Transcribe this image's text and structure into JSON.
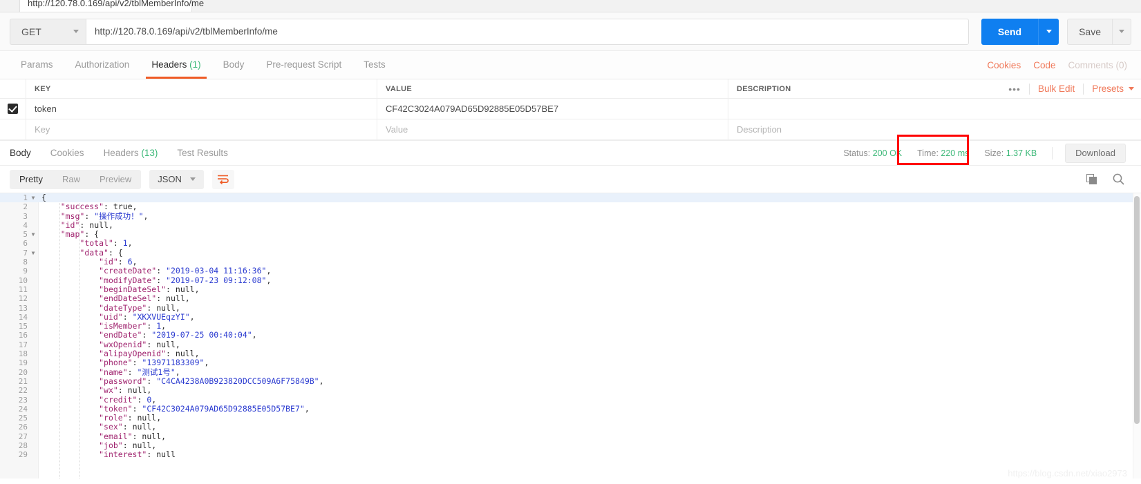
{
  "tabstrip": {
    "title": "http://120.78.0.169/api/v2/tblMemberInfo/me"
  },
  "request": {
    "method": "GET",
    "method_caret": "caret-down-icon",
    "url": "http://120.78.0.169/api/v2/tblMemberInfo/me",
    "send_label": "Send",
    "save_label": "Save",
    "send_color": "#0f7ff0"
  },
  "request_tabs": [
    {
      "label": "Params",
      "count": "",
      "active": false
    },
    {
      "label": "Authorization",
      "count": "",
      "active": false
    },
    {
      "label": "Headers",
      "count": "(1)",
      "active": true
    },
    {
      "label": "Body",
      "count": "",
      "active": false
    },
    {
      "label": "Pre-request Script",
      "count": "",
      "active": false
    },
    {
      "label": "Tests",
      "count": "",
      "active": false
    }
  ],
  "request_tabs_right": {
    "cookies": "Cookies",
    "code": "Code",
    "comments": "Comments (0)",
    "accent": "#ef5b25"
  },
  "headers_table": {
    "columns": {
      "key": "KEY",
      "value": "VALUE",
      "description": "DESCRIPTION"
    },
    "actions": {
      "dots": "•••",
      "bulk_edit": "Bulk Edit",
      "presets": "Presets"
    },
    "rows": [
      {
        "checked": true,
        "key": "token",
        "value": "CF42C3024A079AD65D92885E05D57BE7",
        "description": ""
      }
    ],
    "placeholders": {
      "key": "Key",
      "value": "Value",
      "description": "Description"
    }
  },
  "response_tabs": [
    {
      "label": "Body",
      "count": "",
      "active": true
    },
    {
      "label": "Cookies",
      "count": "",
      "active": false
    },
    {
      "label": "Headers",
      "count": "(13)",
      "active": false
    },
    {
      "label": "Test Results",
      "count": "",
      "active": false
    }
  ],
  "response_meta": {
    "status_label": "Status:",
    "status_value": "200 OK",
    "time_label": "Time:",
    "time_value": "220 ms",
    "size_label": "Size:",
    "size_value": "1.37 KB",
    "download_label": "Download",
    "ok_color": "#3cb878",
    "highlight_color": "#ff0000"
  },
  "body_toolbar": {
    "views": [
      {
        "label": "Pretty",
        "active": true
      },
      {
        "label": "Raw",
        "active": false
      },
      {
        "label": "Preview",
        "active": false
      }
    ],
    "format": "JSON",
    "wrap_icon": "word-wrap-icon",
    "copy_icon": "copy-icon",
    "search_icon": "search-icon"
  },
  "code_lines": [
    {
      "n": "1",
      "fold": true,
      "indent": 0,
      "tokens": [
        {
          "t": "p",
          "v": "{"
        }
      ]
    },
    {
      "n": "2",
      "fold": false,
      "indent": 1,
      "tokens": [
        {
          "t": "k",
          "v": "\"success\""
        },
        {
          "t": "p",
          "v": ": "
        },
        {
          "t": "b",
          "v": "true"
        },
        {
          "t": "p",
          "v": ","
        }
      ]
    },
    {
      "n": "3",
      "fold": false,
      "indent": 1,
      "tokens": [
        {
          "t": "k",
          "v": "\"msg\""
        },
        {
          "t": "p",
          "v": ": "
        },
        {
          "t": "s",
          "v": "\"操作成功！\""
        },
        {
          "t": "p",
          "v": ","
        }
      ]
    },
    {
      "n": "4",
      "fold": false,
      "indent": 1,
      "tokens": [
        {
          "t": "k",
          "v": "\"id\""
        },
        {
          "t": "p",
          "v": ": "
        },
        {
          "t": "b",
          "v": "null"
        },
        {
          "t": "p",
          "v": ","
        }
      ]
    },
    {
      "n": "5",
      "fold": true,
      "indent": 1,
      "tokens": [
        {
          "t": "k",
          "v": "\"map\""
        },
        {
          "t": "p",
          "v": ": {"
        }
      ]
    },
    {
      "n": "6",
      "fold": false,
      "indent": 2,
      "tokens": [
        {
          "t": "k",
          "v": "\"total\""
        },
        {
          "t": "p",
          "v": ": "
        },
        {
          "t": "n",
          "v": "1"
        },
        {
          "t": "p",
          "v": ","
        }
      ]
    },
    {
      "n": "7",
      "fold": true,
      "indent": 2,
      "tokens": [
        {
          "t": "k",
          "v": "\"data\""
        },
        {
          "t": "p",
          "v": ": {"
        }
      ]
    },
    {
      "n": "8",
      "fold": false,
      "indent": 3,
      "tokens": [
        {
          "t": "k",
          "v": "\"id\""
        },
        {
          "t": "p",
          "v": ": "
        },
        {
          "t": "n",
          "v": "6"
        },
        {
          "t": "p",
          "v": ","
        }
      ]
    },
    {
      "n": "9",
      "fold": false,
      "indent": 3,
      "tokens": [
        {
          "t": "k",
          "v": "\"createDate\""
        },
        {
          "t": "p",
          "v": ": "
        },
        {
          "t": "s",
          "v": "\"2019-03-04 11:16:36\""
        },
        {
          "t": "p",
          "v": ","
        }
      ]
    },
    {
      "n": "10",
      "fold": false,
      "indent": 3,
      "tokens": [
        {
          "t": "k",
          "v": "\"modifyDate\""
        },
        {
          "t": "p",
          "v": ": "
        },
        {
          "t": "s",
          "v": "\"2019-07-23 09:12:08\""
        },
        {
          "t": "p",
          "v": ","
        }
      ]
    },
    {
      "n": "11",
      "fold": false,
      "indent": 3,
      "tokens": [
        {
          "t": "k",
          "v": "\"beginDateSel\""
        },
        {
          "t": "p",
          "v": ": "
        },
        {
          "t": "b",
          "v": "null"
        },
        {
          "t": "p",
          "v": ","
        }
      ]
    },
    {
      "n": "12",
      "fold": false,
      "indent": 3,
      "tokens": [
        {
          "t": "k",
          "v": "\"endDateSel\""
        },
        {
          "t": "p",
          "v": ": "
        },
        {
          "t": "b",
          "v": "null"
        },
        {
          "t": "p",
          "v": ","
        }
      ]
    },
    {
      "n": "13",
      "fold": false,
      "indent": 3,
      "tokens": [
        {
          "t": "k",
          "v": "\"dateType\""
        },
        {
          "t": "p",
          "v": ": "
        },
        {
          "t": "b",
          "v": "null"
        },
        {
          "t": "p",
          "v": ","
        }
      ]
    },
    {
      "n": "14",
      "fold": false,
      "indent": 3,
      "tokens": [
        {
          "t": "k",
          "v": "\"uid\""
        },
        {
          "t": "p",
          "v": ": "
        },
        {
          "t": "s",
          "v": "\"XKXVUEqzYI\""
        },
        {
          "t": "p",
          "v": ","
        }
      ]
    },
    {
      "n": "15",
      "fold": false,
      "indent": 3,
      "tokens": [
        {
          "t": "k",
          "v": "\"isMember\""
        },
        {
          "t": "p",
          "v": ": "
        },
        {
          "t": "n",
          "v": "1"
        },
        {
          "t": "p",
          "v": ","
        }
      ]
    },
    {
      "n": "16",
      "fold": false,
      "indent": 3,
      "tokens": [
        {
          "t": "k",
          "v": "\"endDate\""
        },
        {
          "t": "p",
          "v": ": "
        },
        {
          "t": "s",
          "v": "\"2019-07-25 00:40:04\""
        },
        {
          "t": "p",
          "v": ","
        }
      ]
    },
    {
      "n": "17",
      "fold": false,
      "indent": 3,
      "tokens": [
        {
          "t": "k",
          "v": "\"wxOpenid\""
        },
        {
          "t": "p",
          "v": ": "
        },
        {
          "t": "b",
          "v": "null"
        },
        {
          "t": "p",
          "v": ","
        }
      ]
    },
    {
      "n": "18",
      "fold": false,
      "indent": 3,
      "tokens": [
        {
          "t": "k",
          "v": "\"alipayOpenid\""
        },
        {
          "t": "p",
          "v": ": "
        },
        {
          "t": "b",
          "v": "null"
        },
        {
          "t": "p",
          "v": ","
        }
      ]
    },
    {
      "n": "19",
      "fold": false,
      "indent": 3,
      "tokens": [
        {
          "t": "k",
          "v": "\"phone\""
        },
        {
          "t": "p",
          "v": ": "
        },
        {
          "t": "s",
          "v": "\"13971183309\""
        },
        {
          "t": "p",
          "v": ","
        }
      ]
    },
    {
      "n": "20",
      "fold": false,
      "indent": 3,
      "tokens": [
        {
          "t": "k",
          "v": "\"name\""
        },
        {
          "t": "p",
          "v": ": "
        },
        {
          "t": "s",
          "v": "\"测试1号\""
        },
        {
          "t": "p",
          "v": ","
        }
      ]
    },
    {
      "n": "21",
      "fold": false,
      "indent": 3,
      "tokens": [
        {
          "t": "k",
          "v": "\"password\""
        },
        {
          "t": "p",
          "v": ": "
        },
        {
          "t": "s",
          "v": "\"C4CA4238A0B923820DCC509A6F75849B\""
        },
        {
          "t": "p",
          "v": ","
        }
      ]
    },
    {
      "n": "22",
      "fold": false,
      "indent": 3,
      "tokens": [
        {
          "t": "k",
          "v": "\"wx\""
        },
        {
          "t": "p",
          "v": ": "
        },
        {
          "t": "b",
          "v": "null"
        },
        {
          "t": "p",
          "v": ","
        }
      ]
    },
    {
      "n": "23",
      "fold": false,
      "indent": 3,
      "tokens": [
        {
          "t": "k",
          "v": "\"credit\""
        },
        {
          "t": "p",
          "v": ": "
        },
        {
          "t": "n",
          "v": "0"
        },
        {
          "t": "p",
          "v": ","
        }
      ]
    },
    {
      "n": "24",
      "fold": false,
      "indent": 3,
      "tokens": [
        {
          "t": "k",
          "v": "\"token\""
        },
        {
          "t": "p",
          "v": ": "
        },
        {
          "t": "s",
          "v": "\"CF42C3024A079AD65D92885E05D57BE7\""
        },
        {
          "t": "p",
          "v": ","
        }
      ]
    },
    {
      "n": "25",
      "fold": false,
      "indent": 3,
      "tokens": [
        {
          "t": "k",
          "v": "\"role\""
        },
        {
          "t": "p",
          "v": ": "
        },
        {
          "t": "b",
          "v": "null"
        },
        {
          "t": "p",
          "v": ","
        }
      ]
    },
    {
      "n": "26",
      "fold": false,
      "indent": 3,
      "tokens": [
        {
          "t": "k",
          "v": "\"sex\""
        },
        {
          "t": "p",
          "v": ": "
        },
        {
          "t": "b",
          "v": "null"
        },
        {
          "t": "p",
          "v": ","
        }
      ]
    },
    {
      "n": "27",
      "fold": false,
      "indent": 3,
      "tokens": [
        {
          "t": "k",
          "v": "\"email\""
        },
        {
          "t": "p",
          "v": ": "
        },
        {
          "t": "b",
          "v": "null"
        },
        {
          "t": "p",
          "v": ","
        }
      ]
    },
    {
      "n": "28",
      "fold": false,
      "indent": 3,
      "tokens": [
        {
          "t": "k",
          "v": "\"job\""
        },
        {
          "t": "p",
          "v": ": "
        },
        {
          "t": "b",
          "v": "null"
        },
        {
          "t": "p",
          "v": ","
        }
      ]
    },
    {
      "n": "29",
      "fold": false,
      "indent": 3,
      "tokens": [
        {
          "t": "k",
          "v": "\"interest\""
        },
        {
          "t": "p",
          "v": ": "
        },
        {
          "t": "b",
          "v": "null"
        }
      ]
    }
  ],
  "watermark": "https://blog.csdn.net/xiao2973"
}
